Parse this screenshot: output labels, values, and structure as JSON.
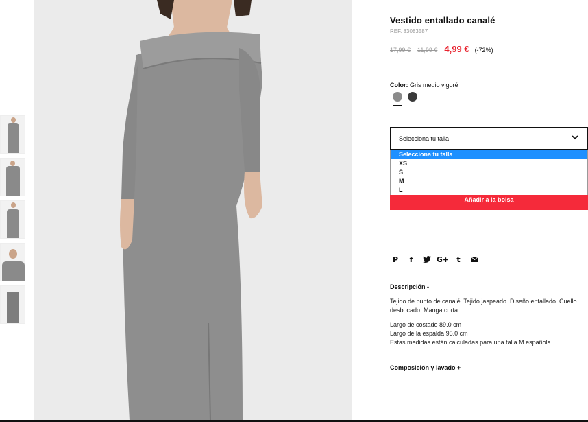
{
  "product": {
    "title": "Vestido entallado canalé",
    "ref": "REF. 83083587",
    "price_original": "17,99 €",
    "price_previous": "11,99 €",
    "price_current": "4,99 €",
    "discount": "(-72%)",
    "accent_color": "#f52a3a"
  },
  "color": {
    "label": "Color:",
    "value": "Gris medio vigoré",
    "swatches": [
      "#8b8b8b",
      "#3a3a3a"
    ]
  },
  "size": {
    "placeholder": "Selecciona tu talla",
    "options": [
      "Selecciona tu talla",
      "XS",
      "S",
      "M",
      "L"
    ]
  },
  "add_to_bag": "Añadir a la bolsa",
  "share_icons": [
    "pinterest-icon",
    "facebook-icon",
    "twitter-icon",
    "google-plus-icon",
    "tumblr-icon",
    "email-icon"
  ],
  "share_glyphs": {
    "pinterest": "P",
    "facebook": "f",
    "twitter": "t",
    "googleplus": "G+",
    "tumblr": "t"
  },
  "description": {
    "title": "Descripción -",
    "text": "Tejido de punto de canalé. Tejido jaspeado. Diseño entallado. Cuello desbocado. Manga corta.",
    "measure_1": "Largo de costado 89.0 cm",
    "measure_2": "Largo de la espalda 95.0 cm",
    "measure_3": "Estas medidas están calculadas para una talla M española."
  },
  "composition_title": "Composición y lavado +"
}
